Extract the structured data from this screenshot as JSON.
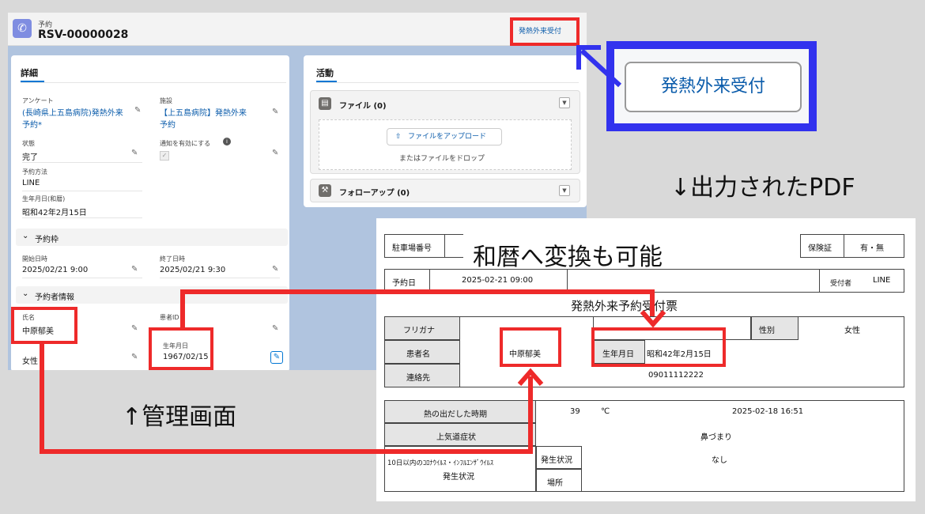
{
  "header": {
    "object_label": "予約",
    "record_id": "RSV-00000028",
    "action_button": "発熱外来受付"
  },
  "detail": {
    "tab": "詳細",
    "fields": {
      "survey_label": "アンケート",
      "survey_value1": "(長崎県上五島病院)発熱外来",
      "survey_value2": "予約*",
      "facility_label": "施設",
      "facility_value1": "【上五島病院】発熱外来",
      "facility_value2": "予約",
      "status_label": "状態",
      "status_value": "完了",
      "notify_label": "通知を有効にする",
      "method_label": "予約方法",
      "method_value": "LINE",
      "birth_label": "生年月日(和暦)",
      "birth_value": "昭和42年2月15日"
    },
    "slot_section": "予約枠",
    "start_label": "開始日時",
    "start_value": "2025/02/21 9:00",
    "end_label": "終了日時",
    "end_value": "2025/02/21 9:30",
    "patient_section": "予約者情報",
    "name_label": "氏名",
    "name_value": "中原郁美",
    "patient_id_label": "患者ID",
    "gender_value": "女性",
    "dob_label": "生年月日",
    "dob_value": "1967/02/15"
  },
  "activity": {
    "tab": "活動",
    "files_title": "ファイル (0)",
    "upload_button": "ファイルをアップロード",
    "drop_text": "またはファイルをドロップ",
    "followup_title": "フォローアップ (0)"
  },
  "callout": {
    "button_text": "発熱外来受付"
  },
  "annotations": {
    "output_pdf": "↓出力されたPDF",
    "wareki": "和暦へ変換も可能",
    "admin_screen": "↑管理画面"
  },
  "pdf": {
    "parking_label": "駐車場番号",
    "insurance_label": "保険証",
    "insurance_value": "有・無",
    "reserve_label": "予約日",
    "reserve_value": "2025-02-21 09:00",
    "receptionist_label": "受付者",
    "receptionist_value": "LINE",
    "title": "発熱外来予約受付票",
    "furigana_label": "フリガナ",
    "gender_label": "性別",
    "gender_value": "女性",
    "name_label": "患者名",
    "name_value": "中原郁美",
    "dob_label": "生年月日",
    "dob_value": "昭和42年2月15日",
    "contact_label": "連絡先",
    "contact_value": "09011112222",
    "fever_label": "熱の出だした時期",
    "fever_temp": "39",
    "fever_unit": "℃",
    "fever_time": "2025-02-18 16:51",
    "airway_label": "上気道症状",
    "airway_value": "鼻づまり",
    "covid_label1": "10日以内のｺﾛﾅｳｲﾙｽ・ｲﾝﾌﾙｴﾝｻﾞｳｲﾙｽ",
    "covid_label2": "発生状況",
    "occurrence_label": "発生状況",
    "occurrence_value": "なし",
    "place_label": "場所"
  },
  "colors": {
    "highlight": "#ee2a2a",
    "callout": "#3232ee",
    "link": "#0b5cab"
  }
}
